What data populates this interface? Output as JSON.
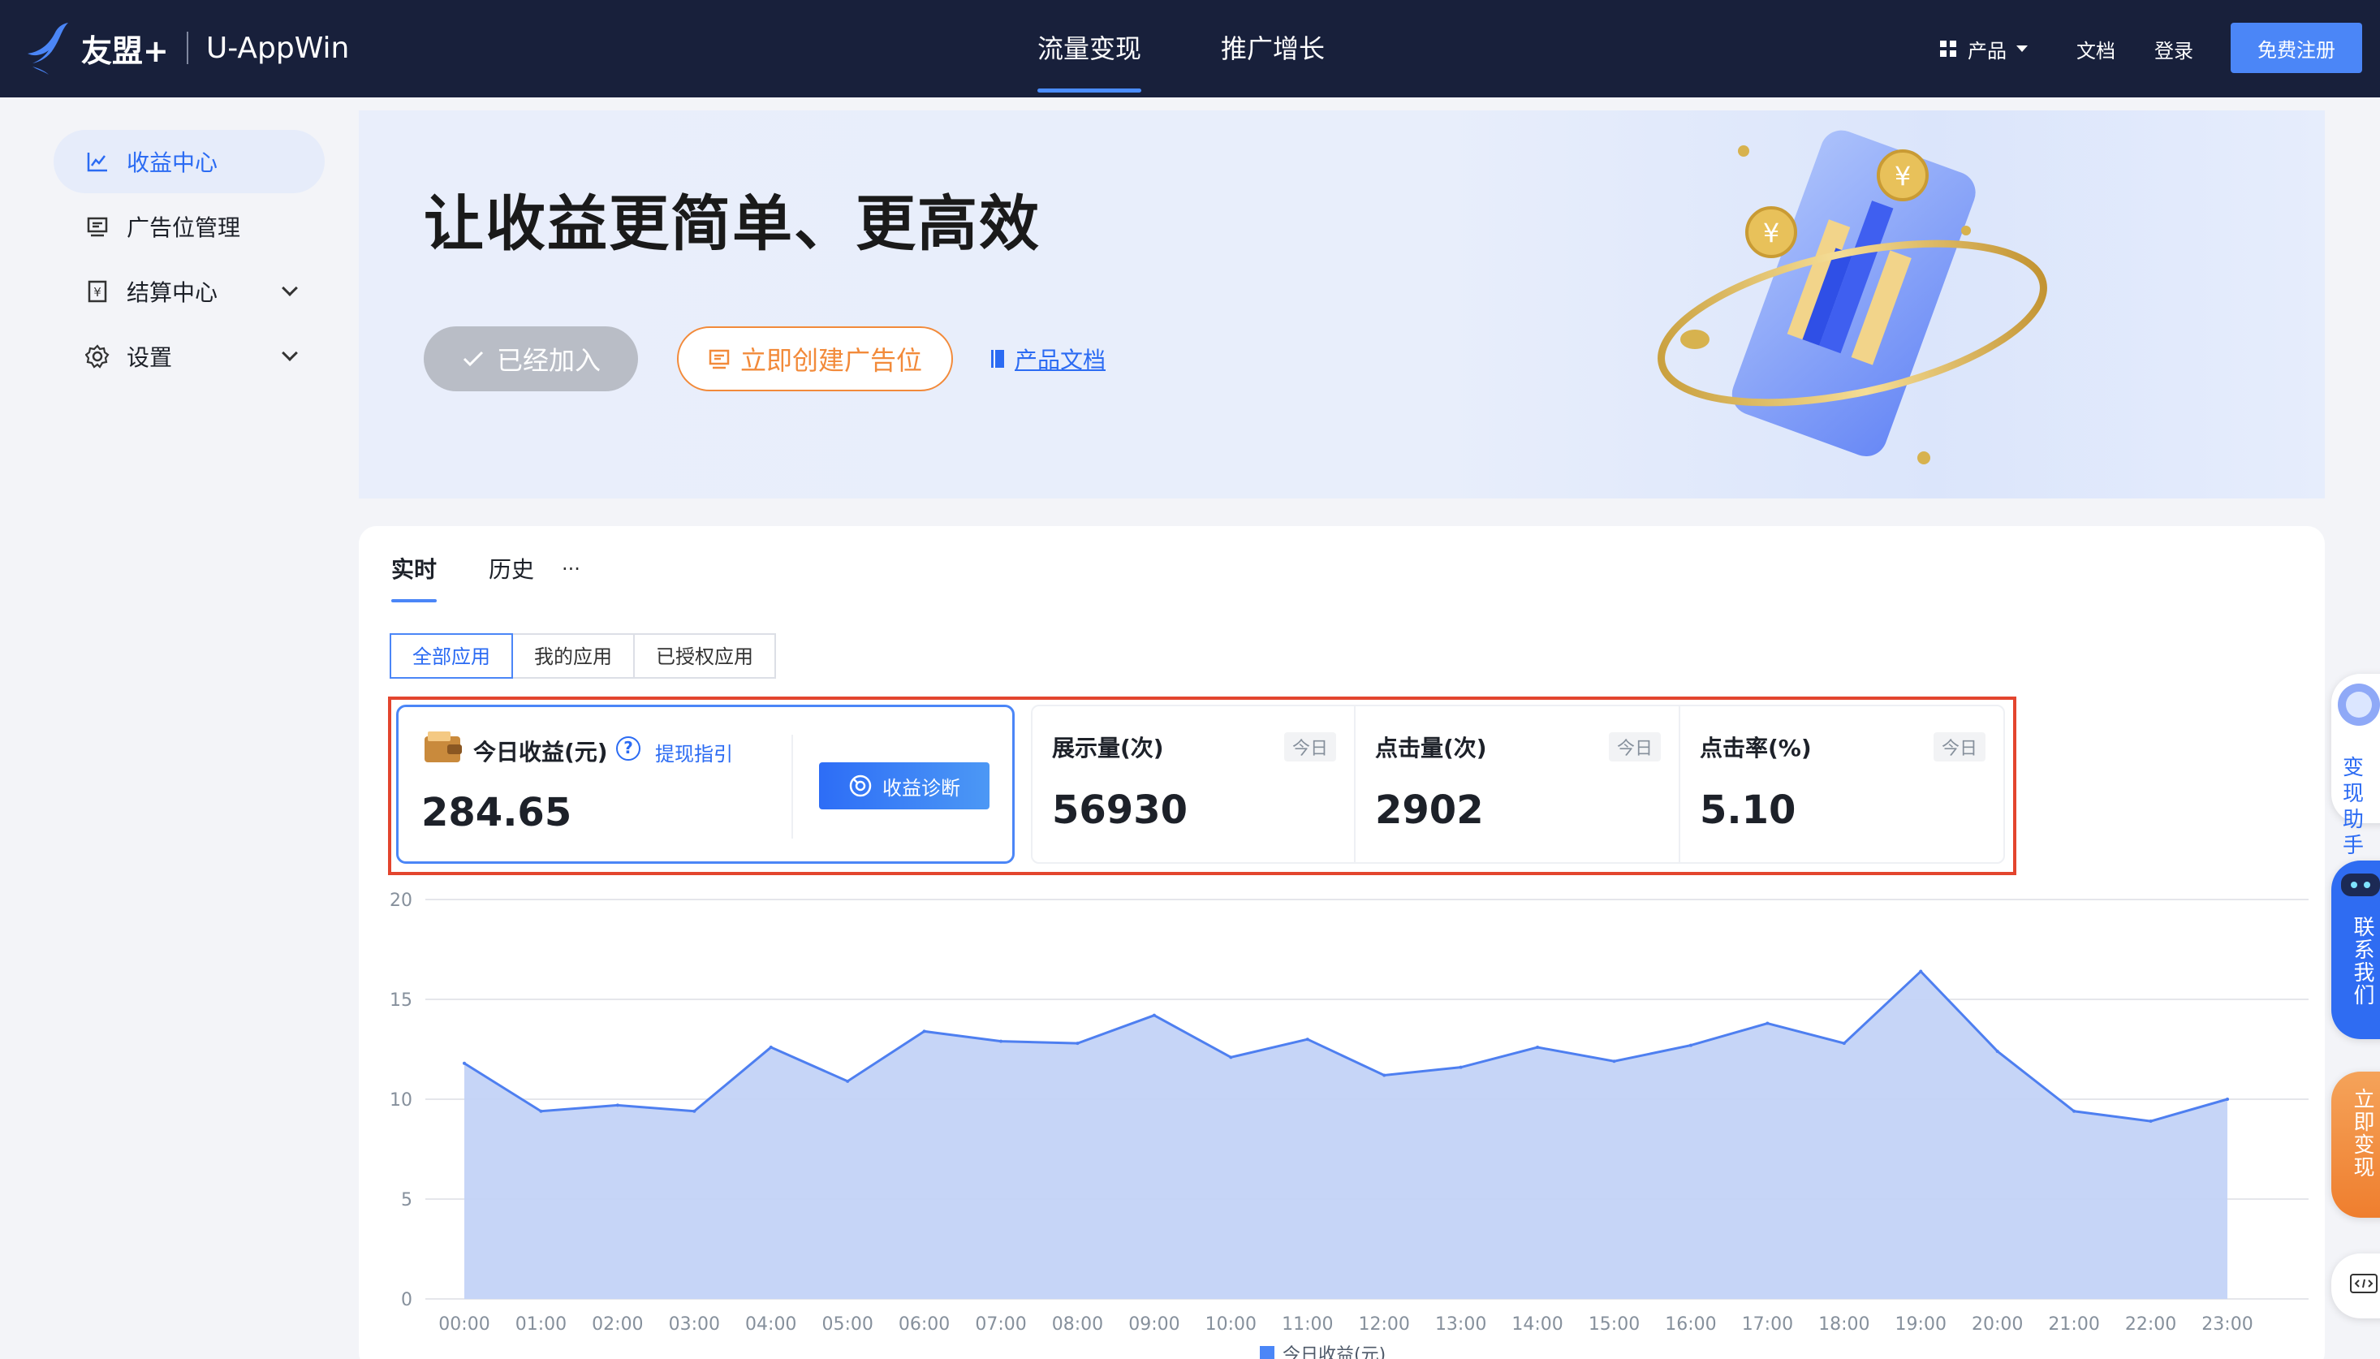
{
  "topnav": {
    "logo_text": "友盟+",
    "logo_sub": "U-AppWin",
    "tabs": [
      {
        "label": "流量变现",
        "active": true
      },
      {
        "label": "推广增长",
        "active": false
      }
    ],
    "product_label": "产品",
    "docs_label": "文档",
    "login_label": "登录",
    "register_label": "免费注册"
  },
  "sidebar": {
    "items": [
      {
        "label": "收益中心",
        "icon": "line-chart-icon",
        "active": true
      },
      {
        "label": "广告位管理",
        "icon": "monitor-icon",
        "active": false
      },
      {
        "label": "结算中心",
        "icon": "yen-doc-icon",
        "active": false,
        "expandable": true
      },
      {
        "label": "设置",
        "icon": "gear-icon",
        "active": false,
        "expandable": true
      }
    ]
  },
  "banner": {
    "title": "让收益更简单、更高效",
    "joined_label": "已经加入",
    "create_label": "立即创建广告位",
    "doc_label": "产品文档"
  },
  "tabs": [
    {
      "label": "实时",
      "active": true
    },
    {
      "label": "历史",
      "active": false
    }
  ],
  "tabs_more": "...",
  "app_filter": {
    "options": [
      "全部应用",
      "我的应用",
      "已授权应用"
    ],
    "selected": "全部应用"
  },
  "revenue": {
    "label": "今日收益(元)",
    "guide_label": "提现指引",
    "value": "284.65",
    "diagnose_label": "收益诊断"
  },
  "stats": [
    {
      "label": "展示量(次)",
      "badge": "今日",
      "value": "56930"
    },
    {
      "label": "点击量(次)",
      "badge": "今日",
      "value": "2902"
    },
    {
      "label": "点击率(%)",
      "badge": "今日",
      "value": "5.10"
    }
  ],
  "floaters": [
    {
      "label": "变现助手"
    },
    {
      "label": "联系我们"
    },
    {
      "label": "立即变现"
    }
  ],
  "colors": {
    "nav_bg": "#18203b",
    "accent": "#4b86f7",
    "orange": "#f28a3a",
    "highlight_red": "#e3452e",
    "area_fill": "#c3d3f7",
    "line": "#4e7ff0"
  },
  "chart_data": {
    "type": "area",
    "x": [
      "00:00",
      "01:00",
      "02:00",
      "03:00",
      "04:00",
      "05:00",
      "06:00",
      "07:00",
      "08:00",
      "09:00",
      "10:00",
      "11:00",
      "12:00",
      "13:00",
      "14:00",
      "15:00",
      "16:00",
      "17:00",
      "18:00",
      "19:00",
      "20:00",
      "21:00",
      "22:00",
      "23:00"
    ],
    "series": [
      {
        "name": "今日收益(元)",
        "values": [
          11.8,
          9.4,
          9.7,
          9.4,
          12.6,
          10.9,
          13.4,
          12.9,
          12.8,
          14.2,
          12.1,
          13.0,
          11.2,
          11.6,
          12.6,
          11.9,
          12.7,
          13.8,
          12.8,
          16.4,
          12.4,
          9.4,
          8.9,
          10.0
        ]
      }
    ],
    "yticks": [
      "0",
      "5",
      "10",
      "15",
      "20"
    ],
    "ylim": [
      0,
      20
    ],
    "grid": true,
    "legend": "bottom-center"
  }
}
